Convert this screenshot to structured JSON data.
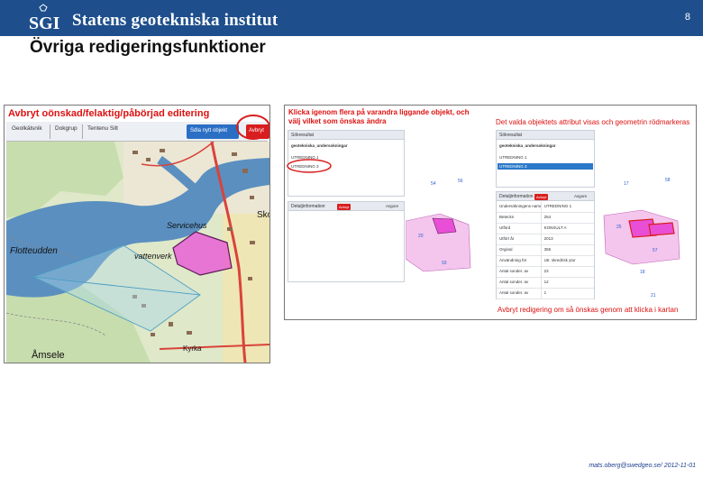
{
  "header": {
    "org_name": "Statens geotekniska institut",
    "logo_abbr": "SGI",
    "slide_number": "8"
  },
  "slide": {
    "title": "Övriga redigeringsfunktioner"
  },
  "left_shot": {
    "caption": "Avbryt oönskad/felaktig/påbörjad editering",
    "toolbar": {
      "items": [
        "Geolkälsnik",
        "Dokgrup",
        "Tentenu Silt"
      ],
      "new_object_button": "Sdla nytt objekt",
      "cancel_button": "Avbryt"
    },
    "map_labels": {
      "flotteudden": "Flotteudden",
      "servicehus": "Servicehus",
      "vattenverk": "vattenverk",
      "sko": "Sko",
      "amsele": "Åmsele",
      "kyrka": "Kyrka"
    }
  },
  "right_shot": {
    "caption_left": "Klicka igenom flera på varandra liggande objekt, och välj vilket som önskas ändra",
    "caption_right": "Det valda objektets attribut visas och geometrin rödmarkeras",
    "caption_bottom": "Avbryt redigering om så önskas genom att klicka i kartan",
    "panel_a": {
      "header": "Sökresultat",
      "layer_row": "geotekniska_undersokningar",
      "items": [
        "UTREDNING 1",
        "UTREDNING 3"
      ]
    },
    "panel_a_detail": {
      "header": "Detaljinformation",
      "badge": "Avbryt",
      "extra": "Avgore"
    },
    "panel_b": {
      "header": "Sökresultat",
      "layer_row": "geotekniska_undersokningar",
      "items": [
        "UTREDNING 1",
        "UTREDNING 3"
      ]
    },
    "panel_b_detail": {
      "header": "Detaljinformation",
      "badge": "Avbryt",
      "extra": "Avgore",
      "rows": [
        {
          "k": "Undersökningens namn",
          "v": "UTREDNING 1"
        },
        {
          "k": "Beteckn",
          "v": "254"
        },
        {
          "k": "Utförd",
          "v": "KONSULT A"
        },
        {
          "k": "Utfört år",
          "v": "2013"
        },
        {
          "k": "Orginal",
          "v": "355"
        },
        {
          "k": "Användning för",
          "v": "Utr. skredrisk ytor"
        },
        {
          "k": "Antal sonder. av",
          "v": "23"
        },
        {
          "k": "Antal sonder. av",
          "v": "12"
        },
        {
          "k": "Antal sonder. av",
          "v": "1"
        }
      ]
    },
    "map_numbers_a": [
      "54",
      "56",
      "20",
      "93"
    ],
    "map_numbers_b": [
      "17",
      "58",
      "25",
      "57",
      "18",
      "21"
    ]
  },
  "footer": {
    "text": "mats.oberg@swedgeo.se/ 2012-11-01"
  },
  "colors": {
    "header_blue": "#1e4f8c",
    "accent_red": "#d81e1e",
    "water_blue": "#5b8fc0",
    "land_green": "#cfe3b4",
    "highlight_magenta": "#e84fd6"
  }
}
